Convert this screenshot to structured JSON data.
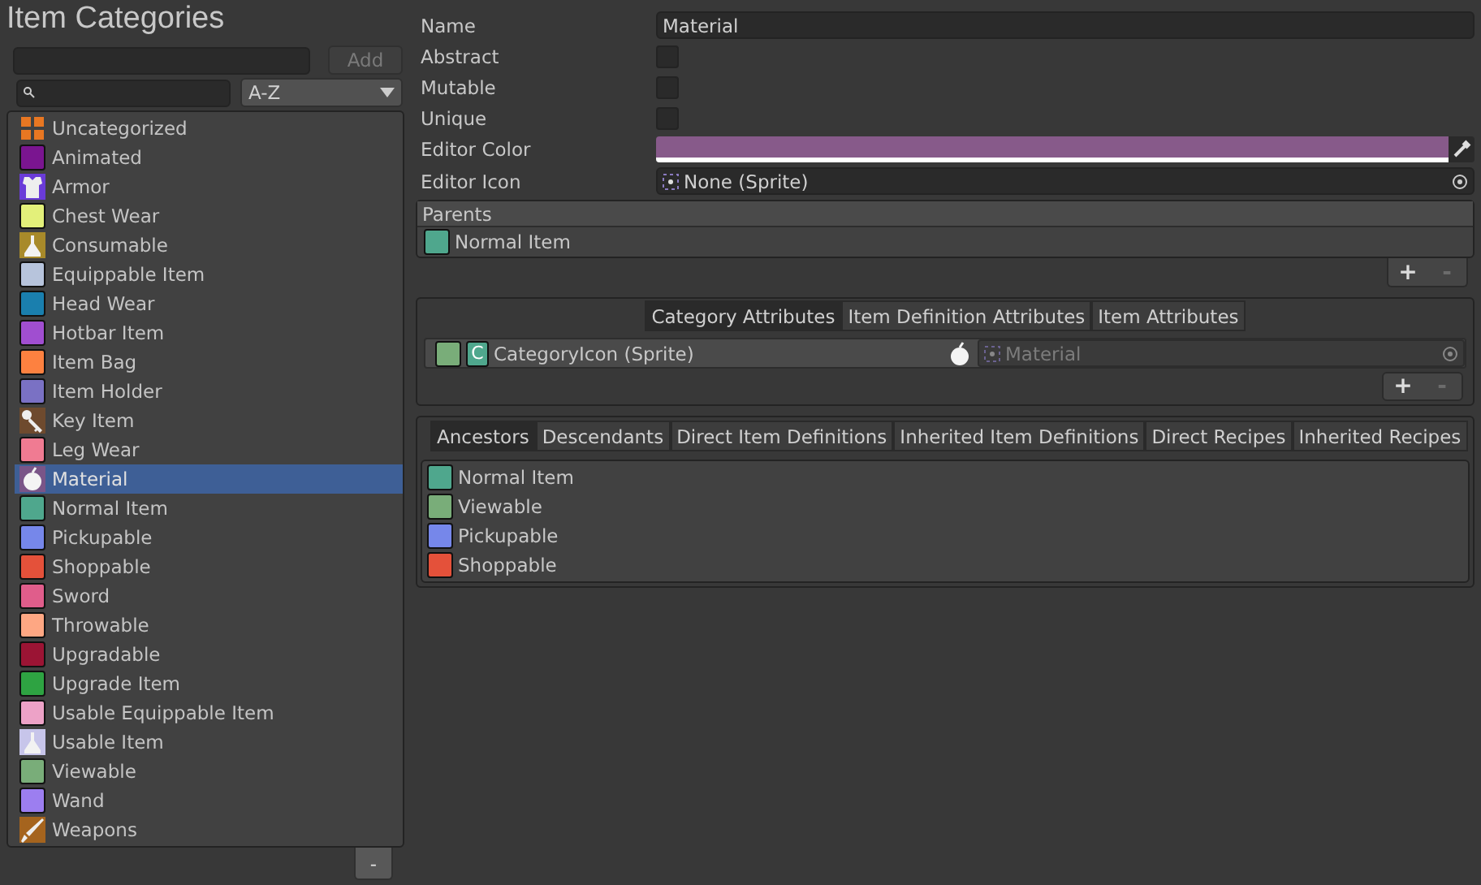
{
  "title": "Item Categories",
  "new_category": {
    "add_button": "Add"
  },
  "sort": {
    "value": "A-Z"
  },
  "categories": [
    {
      "name": "Uncategorized",
      "kind": "grid",
      "color": "#e87722",
      "selected": false
    },
    {
      "name": "Animated",
      "kind": "swatch",
      "color": "#7a1590",
      "selected": false
    },
    {
      "name": "Armor",
      "kind": "armor",
      "color": "#6a3bd8",
      "selected": false
    },
    {
      "name": "Chest Wear",
      "kind": "swatch",
      "color": "#e3f07a",
      "selected": false
    },
    {
      "name": "Consumable",
      "kind": "potion",
      "color": "#a88a2a",
      "selected": false
    },
    {
      "name": "Equippable Item",
      "kind": "swatch",
      "color": "#b7c4dc",
      "selected": false
    },
    {
      "name": "Head Wear",
      "kind": "swatch",
      "color": "#1a7fae",
      "selected": false
    },
    {
      "name": "Hotbar Item",
      "kind": "swatch",
      "color": "#a04ed0",
      "selected": false
    },
    {
      "name": "Item Bag",
      "kind": "swatch",
      "color": "#fd8140",
      "selected": false
    },
    {
      "name": "Item Holder",
      "kind": "swatch",
      "color": "#7a71c4",
      "selected": false
    },
    {
      "name": "Key Item",
      "kind": "key",
      "color": "#6e4a2e",
      "selected": false
    },
    {
      "name": "Leg Wear",
      "kind": "swatch",
      "color": "#f07b92",
      "selected": false
    },
    {
      "name": "Material",
      "kind": "apple",
      "color": "#7a5588",
      "selected": true
    },
    {
      "name": "Normal Item",
      "kind": "swatch",
      "color": "#4fa78d",
      "selected": false
    },
    {
      "name": "Pickupable",
      "kind": "swatch",
      "color": "#7687ea",
      "selected": false
    },
    {
      "name": "Shoppable",
      "kind": "swatch",
      "color": "#e4513a",
      "selected": false
    },
    {
      "name": "Sword",
      "kind": "swatch",
      "color": "#e05d8b",
      "selected": false
    },
    {
      "name": "Throwable",
      "kind": "swatch",
      "color": "#fea783",
      "selected": false
    },
    {
      "name": "Upgradable",
      "kind": "swatch",
      "color": "#9b1434",
      "selected": false
    },
    {
      "name": "Upgrade Item",
      "kind": "swatch",
      "color": "#2ea342",
      "selected": false
    },
    {
      "name": "Usable Equippable Item",
      "kind": "swatch",
      "color": "#eda2c7",
      "selected": false
    },
    {
      "name": "Usable Item",
      "kind": "potion",
      "color": "#c7c5ea",
      "selected": false
    },
    {
      "name": "Viewable",
      "kind": "swatch",
      "color": "#79ad79",
      "selected": false
    },
    {
      "name": "Wand",
      "kind": "swatch",
      "color": "#9c7ef0",
      "selected": false
    },
    {
      "name": "Weapons",
      "kind": "sword",
      "color": "#a5641e",
      "selected": false
    }
  ],
  "remove_button": "-",
  "properties": [
    {
      "label": "Name",
      "kind": "text",
      "value": "Material"
    },
    {
      "label": "Abstract",
      "kind": "checkbox",
      "checked": false
    },
    {
      "label": "Mutable",
      "kind": "checkbox",
      "checked": false
    },
    {
      "label": "Unique",
      "kind": "checkbox",
      "checked": false
    },
    {
      "label": "Editor Color",
      "kind": "color",
      "color": "#875a8a"
    },
    {
      "label": "Editor Icon",
      "kind": "object",
      "value": "None (Sprite)"
    }
  ],
  "parents": {
    "header": "Parents",
    "items": [
      {
        "name": "Normal Item",
        "color": "#4fa78d"
      }
    ],
    "add": "+",
    "remove": "-"
  },
  "attribute_tabs": [
    {
      "label": "Category Attributes",
      "selected": true
    },
    {
      "label": "Item Definition Attributes",
      "selected": false
    },
    {
      "label": "Item Attributes",
      "selected": false
    }
  ],
  "attributes": [
    {
      "color": "#79ad79",
      "badge": {
        "text": "C",
        "color": "#4fa78d"
      },
      "name": "CategoryIcon (Sprite)",
      "value": "Material",
      "disabled": true
    }
  ],
  "attribute_buttons": {
    "add": "+",
    "remove": "-"
  },
  "relation_tabs": [
    {
      "label": "Ancestors",
      "selected": true
    },
    {
      "label": "Descendants",
      "selected": false
    },
    {
      "label": "Direct Item Definitions",
      "selected": false
    },
    {
      "label": "Inherited Item Definitions",
      "selected": false
    },
    {
      "label": "Direct Recipes",
      "selected": false
    },
    {
      "label": "Inherited Recipes",
      "selected": false
    }
  ],
  "relations": [
    {
      "name": "Normal Item",
      "color": "#4fa78d"
    },
    {
      "name": "Viewable",
      "color": "#79ad79"
    },
    {
      "name": "Pickupable",
      "color": "#7687ea"
    },
    {
      "name": "Shoppable",
      "color": "#e4513a"
    }
  ]
}
